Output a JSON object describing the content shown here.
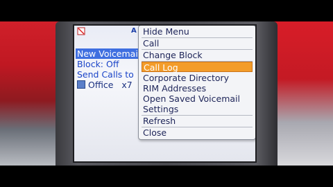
{
  "status": {
    "letter": "A"
  },
  "background_list": {
    "items": [
      {
        "label": "New Voicemail",
        "selected": true
      },
      {
        "label": "Block: Off",
        "selected": false
      },
      {
        "label": "Send Calls to",
        "selected": false
      },
      {
        "label": "Office   x7",
        "selected": false
      }
    ]
  },
  "menu": {
    "items": [
      {
        "label": "Hide Menu"
      },
      {
        "label": "Call"
      },
      {
        "label": "Change Block"
      },
      {
        "label": "Call Log",
        "active": true
      },
      {
        "label": "Corporate Directory"
      },
      {
        "label": "RIM Addresses"
      },
      {
        "label": "Open Saved Voicemail"
      },
      {
        "label": "Settings"
      },
      {
        "label": "Refresh"
      },
      {
        "label": "Close"
      }
    ]
  },
  "colors": {
    "highlight": "#f39c29",
    "selection": "#3f6fe0",
    "link": "#1a44c8"
  }
}
